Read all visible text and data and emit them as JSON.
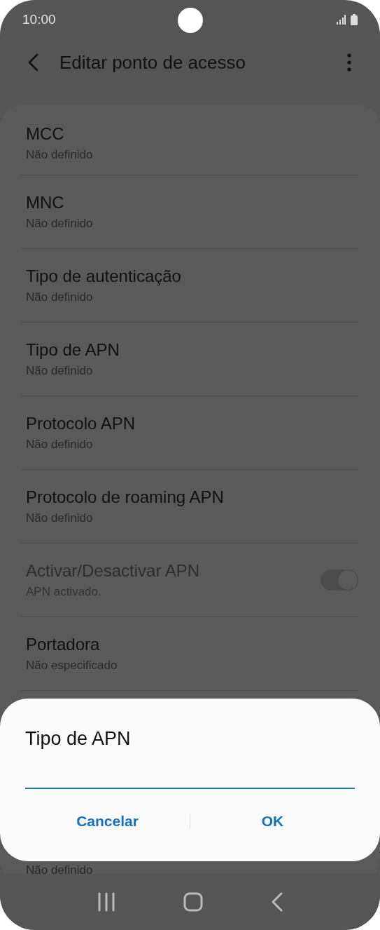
{
  "status_bar": {
    "time": "10:00"
  },
  "header": {
    "title": "Editar ponto de acesso"
  },
  "settings": [
    {
      "kind": "text",
      "title": "MCC",
      "value": "Não definido",
      "disabled": false
    },
    {
      "kind": "text",
      "title": "MNC",
      "value": "Não definido",
      "disabled": false
    },
    {
      "kind": "text",
      "title": "Tipo de autenticação",
      "value": "Não definido",
      "disabled": false
    },
    {
      "kind": "text",
      "title": "Tipo de APN",
      "value": "Não definido",
      "disabled": false
    },
    {
      "kind": "text",
      "title": "Protocolo APN",
      "value": "Não definido",
      "disabled": false
    },
    {
      "kind": "text",
      "title": "Protocolo de roaming APN",
      "value": "Não definido",
      "disabled": false
    },
    {
      "kind": "switch",
      "title": "Activar/Desactivar APN",
      "value": "APN activado.",
      "disabled": true,
      "on": true
    },
    {
      "kind": "text",
      "title": "Portadora",
      "value": "Não especificado",
      "disabled": false
    },
    {
      "kind": "hidden",
      "value": "Não definido"
    }
  ],
  "dialog": {
    "title": "Tipo de APN",
    "buttons": [
      "Cancelar",
      "OK"
    ]
  }
}
